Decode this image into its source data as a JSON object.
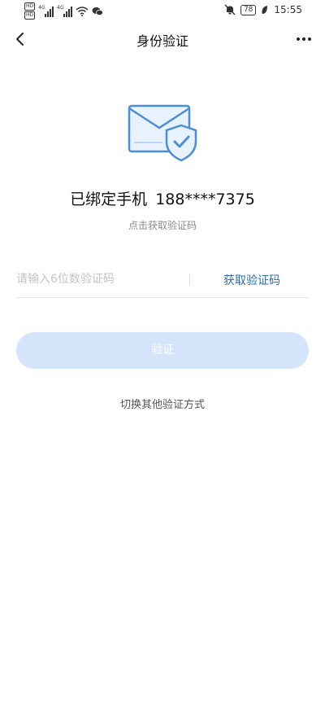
{
  "status_bar": {
    "hd1": "HD",
    "hd2": "HD",
    "net1": "4G",
    "net2": "4G",
    "battery": "78",
    "time": "15:55"
  },
  "nav": {
    "title": "身份验证"
  },
  "verify": {
    "bound_label": "已绑定手机",
    "phone": "188****7375",
    "hint": "点击获取验证码",
    "code_placeholder": "请输入6位数验证码",
    "get_code_label": "获取验证码",
    "verify_button": "验证",
    "switch_method": "切换其他验证方式"
  },
  "colors": {
    "accent": "#2c6dab",
    "button_disabled": "#d3e4fb",
    "icon_blue": "#4a8fd6",
    "icon_fill": "#e8f2fd"
  },
  "icons": [
    "back-icon",
    "more-icon",
    "envelope-shield-icon",
    "mute-icon",
    "battery-icon",
    "wifi-icon",
    "wechat-icon"
  ]
}
